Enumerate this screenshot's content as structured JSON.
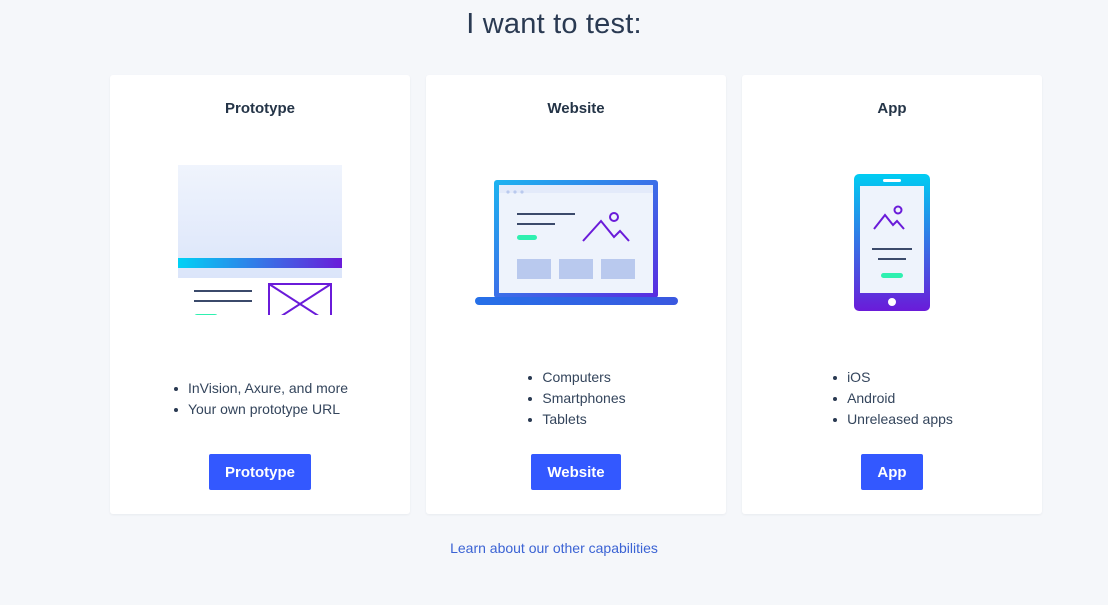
{
  "heading": "I want to test:",
  "cards": [
    {
      "title": "Prototype",
      "illustration_icon": "prototype-wireframe-icon",
      "bullets": [
        "InVision, Axure, and more",
        "Your own prototype URL"
      ],
      "button_label": "Prototype"
    },
    {
      "title": "Website",
      "illustration_icon": "laptop-icon",
      "bullets": [
        "Computers",
        "Smartphones",
        "Tablets"
      ],
      "button_label": "Website"
    },
    {
      "title": "App",
      "illustration_icon": "smartphone-icon",
      "bullets": [
        "iOS",
        "Android",
        "Unreleased apps"
      ],
      "button_label": "App"
    }
  ],
  "footer_link": "Learn about our other capabilities",
  "colors": {
    "accent": "#3358ff",
    "link": "#3b63d4",
    "background": "#f5f7fa",
    "gradient_cyan": "#00d2f5",
    "gradient_purple": "#6a1bd9",
    "highlight_green": "#2ff0b0"
  }
}
